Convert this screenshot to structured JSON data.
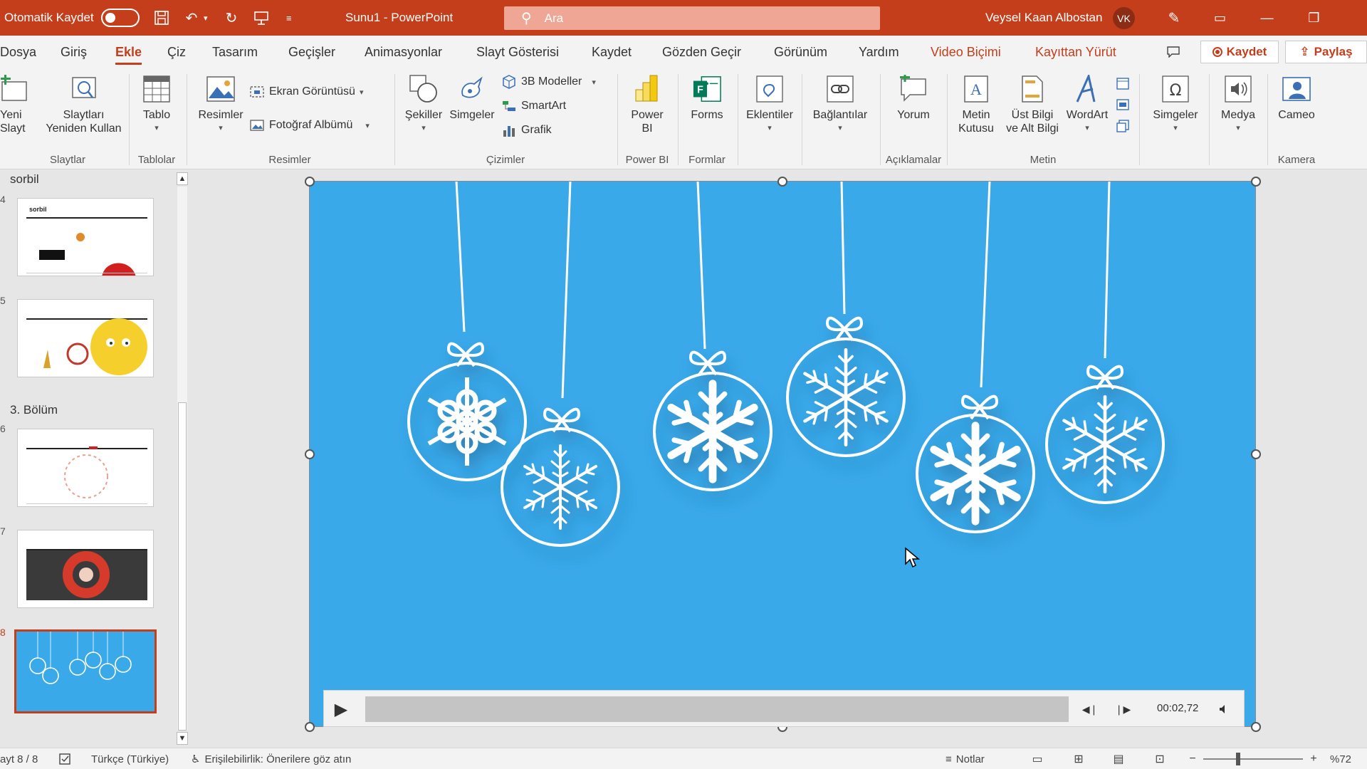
{
  "titlebar": {
    "autosave_label": "Otomatik Kaydet",
    "doc_title": "Sunu1  -  PowerPoint",
    "search_placeholder": "Ara",
    "user_name": "Veysel Kaan Albostan",
    "user_initials": "VK"
  },
  "tabs": [
    "Dosya",
    "Giriş",
    "Ekle",
    "Çiz",
    "Tasarım",
    "Geçişler",
    "Animasyonlar",
    "Slayt Gösterisi",
    "Kaydet",
    "Gözden Geçir",
    "Görünüm",
    "Yardım",
    "Video Biçimi",
    "Kayıttan Yürüt"
  ],
  "active_tab": "Ekle",
  "tab_actions": {
    "record": "Kaydet",
    "share": "Paylaş"
  },
  "ribbon": {
    "slaytlar": {
      "new_slide_1": "Yeni",
      "new_slide_2": "Slayt",
      "reuse_1": "Slaytları",
      "reuse_2": "Yeniden Kullan",
      "group": "Slaytlar"
    },
    "tablolar": {
      "table": "Tablo",
      "group": "Tablolar"
    },
    "resimler": {
      "pictures": "Resimler",
      "screenshot": "Ekran Görüntüsü",
      "photo_album": "Fotoğraf Albümü",
      "group": "Resimler"
    },
    "cizimler": {
      "shapes": "Şekiller",
      "icons": "Simgeler",
      "models3d": "3B Modeller",
      "smartart": "SmartArt",
      "chart": "Grafik",
      "group": "Çizimler"
    },
    "powerbi": {
      "label_1": "Power",
      "label_2": "BI",
      "group": "Power BI"
    },
    "formlar": {
      "forms": "Forms",
      "group": "Formlar"
    },
    "eklentiler": {
      "addins": "Eklentiler"
    },
    "baglantilar": {
      "links": "Bağlantılar"
    },
    "aciklamalar": {
      "comment": "Yorum",
      "group": "Açıklamalar"
    },
    "metin": {
      "textbox_1": "Metin",
      "textbox_2": "Kutusu",
      "header_1": "Üst Bilgi",
      "header_2": "ve Alt Bilgi",
      "wordart": "WordArt",
      "group": "Metin"
    },
    "simgeler": {
      "symbols": "Simgeler"
    },
    "medya": {
      "media": "Medya"
    },
    "kamera": {
      "cameo": "Cameo",
      "group": "Kamera"
    }
  },
  "slide_panel": {
    "sections": [
      {
        "name": "sorbil"
      },
      {
        "name": "3. Bölüm"
      }
    ],
    "thumb1_text": "sorbil"
  },
  "media_bar": {
    "time": "00:02,72"
  },
  "statusbar": {
    "slide_info": "ayt 8 / 8",
    "language": "Türkçe (Türkiye)",
    "accessibility": "Erişilebilirlik: Önerilere göz atın",
    "notes": "Notlar",
    "zoom": "%72"
  },
  "colors": {
    "accent": "#c43e1c",
    "video_bg": "#3aa9ea"
  },
  "icons": [
    "save-icon",
    "undo-icon",
    "redo-icon",
    "present-icon",
    "search-icon",
    "pen-icon",
    "ribbon-display-icon",
    "minimize-icon",
    "restore-icon",
    "comments-icon",
    "record-icon",
    "share-icon",
    "play-icon",
    "back-icon",
    "forward-icon",
    "volume-icon",
    "accessibility-icon",
    "notes-icon"
  ]
}
